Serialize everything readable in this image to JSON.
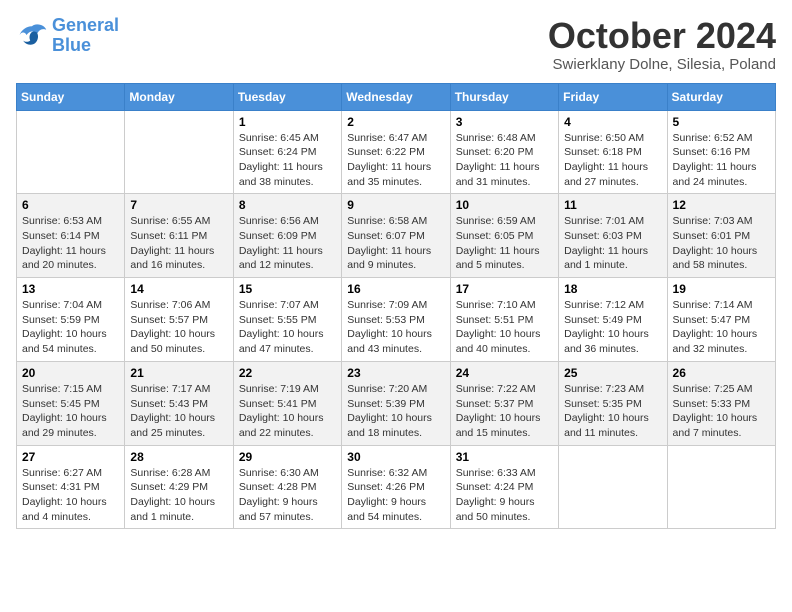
{
  "header": {
    "logo_general": "General",
    "logo_blue": "Blue",
    "month_title": "October 2024",
    "subtitle": "Swierklany Dolne, Silesia, Poland"
  },
  "days_of_week": [
    "Sunday",
    "Monday",
    "Tuesday",
    "Wednesday",
    "Thursday",
    "Friday",
    "Saturday"
  ],
  "weeks": [
    [
      {
        "day": "",
        "info": ""
      },
      {
        "day": "",
        "info": ""
      },
      {
        "day": "1",
        "info": "Sunrise: 6:45 AM\nSunset: 6:24 PM\nDaylight: 11 hours and 38 minutes."
      },
      {
        "day": "2",
        "info": "Sunrise: 6:47 AM\nSunset: 6:22 PM\nDaylight: 11 hours and 35 minutes."
      },
      {
        "day": "3",
        "info": "Sunrise: 6:48 AM\nSunset: 6:20 PM\nDaylight: 11 hours and 31 minutes."
      },
      {
        "day": "4",
        "info": "Sunrise: 6:50 AM\nSunset: 6:18 PM\nDaylight: 11 hours and 27 minutes."
      },
      {
        "day": "5",
        "info": "Sunrise: 6:52 AM\nSunset: 6:16 PM\nDaylight: 11 hours and 24 minutes."
      }
    ],
    [
      {
        "day": "6",
        "info": "Sunrise: 6:53 AM\nSunset: 6:14 PM\nDaylight: 11 hours and 20 minutes."
      },
      {
        "day": "7",
        "info": "Sunrise: 6:55 AM\nSunset: 6:11 PM\nDaylight: 11 hours and 16 minutes."
      },
      {
        "day": "8",
        "info": "Sunrise: 6:56 AM\nSunset: 6:09 PM\nDaylight: 11 hours and 12 minutes."
      },
      {
        "day": "9",
        "info": "Sunrise: 6:58 AM\nSunset: 6:07 PM\nDaylight: 11 hours and 9 minutes."
      },
      {
        "day": "10",
        "info": "Sunrise: 6:59 AM\nSunset: 6:05 PM\nDaylight: 11 hours and 5 minutes."
      },
      {
        "day": "11",
        "info": "Sunrise: 7:01 AM\nSunset: 6:03 PM\nDaylight: 11 hours and 1 minute."
      },
      {
        "day": "12",
        "info": "Sunrise: 7:03 AM\nSunset: 6:01 PM\nDaylight: 10 hours and 58 minutes."
      }
    ],
    [
      {
        "day": "13",
        "info": "Sunrise: 7:04 AM\nSunset: 5:59 PM\nDaylight: 10 hours and 54 minutes."
      },
      {
        "day": "14",
        "info": "Sunrise: 7:06 AM\nSunset: 5:57 PM\nDaylight: 10 hours and 50 minutes."
      },
      {
        "day": "15",
        "info": "Sunrise: 7:07 AM\nSunset: 5:55 PM\nDaylight: 10 hours and 47 minutes."
      },
      {
        "day": "16",
        "info": "Sunrise: 7:09 AM\nSunset: 5:53 PM\nDaylight: 10 hours and 43 minutes."
      },
      {
        "day": "17",
        "info": "Sunrise: 7:10 AM\nSunset: 5:51 PM\nDaylight: 10 hours and 40 minutes."
      },
      {
        "day": "18",
        "info": "Sunrise: 7:12 AM\nSunset: 5:49 PM\nDaylight: 10 hours and 36 minutes."
      },
      {
        "day": "19",
        "info": "Sunrise: 7:14 AM\nSunset: 5:47 PM\nDaylight: 10 hours and 32 minutes."
      }
    ],
    [
      {
        "day": "20",
        "info": "Sunrise: 7:15 AM\nSunset: 5:45 PM\nDaylight: 10 hours and 29 minutes."
      },
      {
        "day": "21",
        "info": "Sunrise: 7:17 AM\nSunset: 5:43 PM\nDaylight: 10 hours and 25 minutes."
      },
      {
        "day": "22",
        "info": "Sunrise: 7:19 AM\nSunset: 5:41 PM\nDaylight: 10 hours and 22 minutes."
      },
      {
        "day": "23",
        "info": "Sunrise: 7:20 AM\nSunset: 5:39 PM\nDaylight: 10 hours and 18 minutes."
      },
      {
        "day": "24",
        "info": "Sunrise: 7:22 AM\nSunset: 5:37 PM\nDaylight: 10 hours and 15 minutes."
      },
      {
        "day": "25",
        "info": "Sunrise: 7:23 AM\nSunset: 5:35 PM\nDaylight: 10 hours and 11 minutes."
      },
      {
        "day": "26",
        "info": "Sunrise: 7:25 AM\nSunset: 5:33 PM\nDaylight: 10 hours and 7 minutes."
      }
    ],
    [
      {
        "day": "27",
        "info": "Sunrise: 6:27 AM\nSunset: 4:31 PM\nDaylight: 10 hours and 4 minutes."
      },
      {
        "day": "28",
        "info": "Sunrise: 6:28 AM\nSunset: 4:29 PM\nDaylight: 10 hours and 1 minute."
      },
      {
        "day": "29",
        "info": "Sunrise: 6:30 AM\nSunset: 4:28 PM\nDaylight: 9 hours and 57 minutes."
      },
      {
        "day": "30",
        "info": "Sunrise: 6:32 AM\nSunset: 4:26 PM\nDaylight: 9 hours and 54 minutes."
      },
      {
        "day": "31",
        "info": "Sunrise: 6:33 AM\nSunset: 4:24 PM\nDaylight: 9 hours and 50 minutes."
      },
      {
        "day": "",
        "info": ""
      },
      {
        "day": "",
        "info": ""
      }
    ]
  ]
}
